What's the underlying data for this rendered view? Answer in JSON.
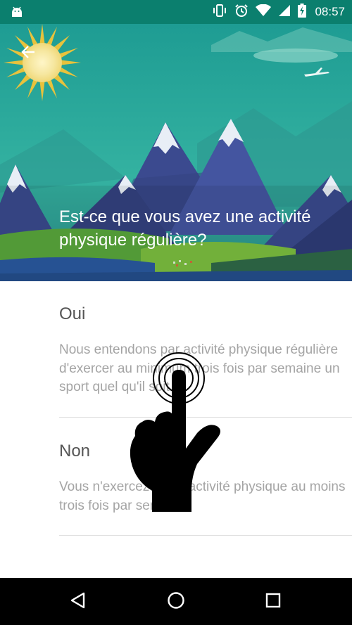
{
  "status_bar": {
    "time": "08:57",
    "icons": [
      "android-icon",
      "vibrate-icon",
      "alarm-icon",
      "wifi-icon",
      "signal-icon",
      "battery-charging-icon"
    ],
    "color": "#0b7f6e"
  },
  "header": {
    "back_icon": "arrow-left-icon",
    "question": "Est-ce que vous avez une activité physique régulière?"
  },
  "options": [
    {
      "title": "Oui",
      "description": "Nous entendons par activité physique régulière d'exercer au minimum trois fois par semaine un sport quel qu'il soit"
    },
    {
      "title": "Non",
      "description": "Vous n'exercez pas d'activité physique au moins trois fois par semaine"
    }
  ],
  "nav_bar": {
    "icons": [
      "back-triangle-icon",
      "home-circle-icon",
      "recents-square-icon"
    ]
  },
  "overlay": {
    "icon": "tap-gesture-hand-icon"
  },
  "colors": {
    "sky": "#2aa79b",
    "mountain": "#3a4a8e",
    "grass": "#5aa83c",
    "title_text": "#555555",
    "desc_text": "#a4a4a4"
  }
}
